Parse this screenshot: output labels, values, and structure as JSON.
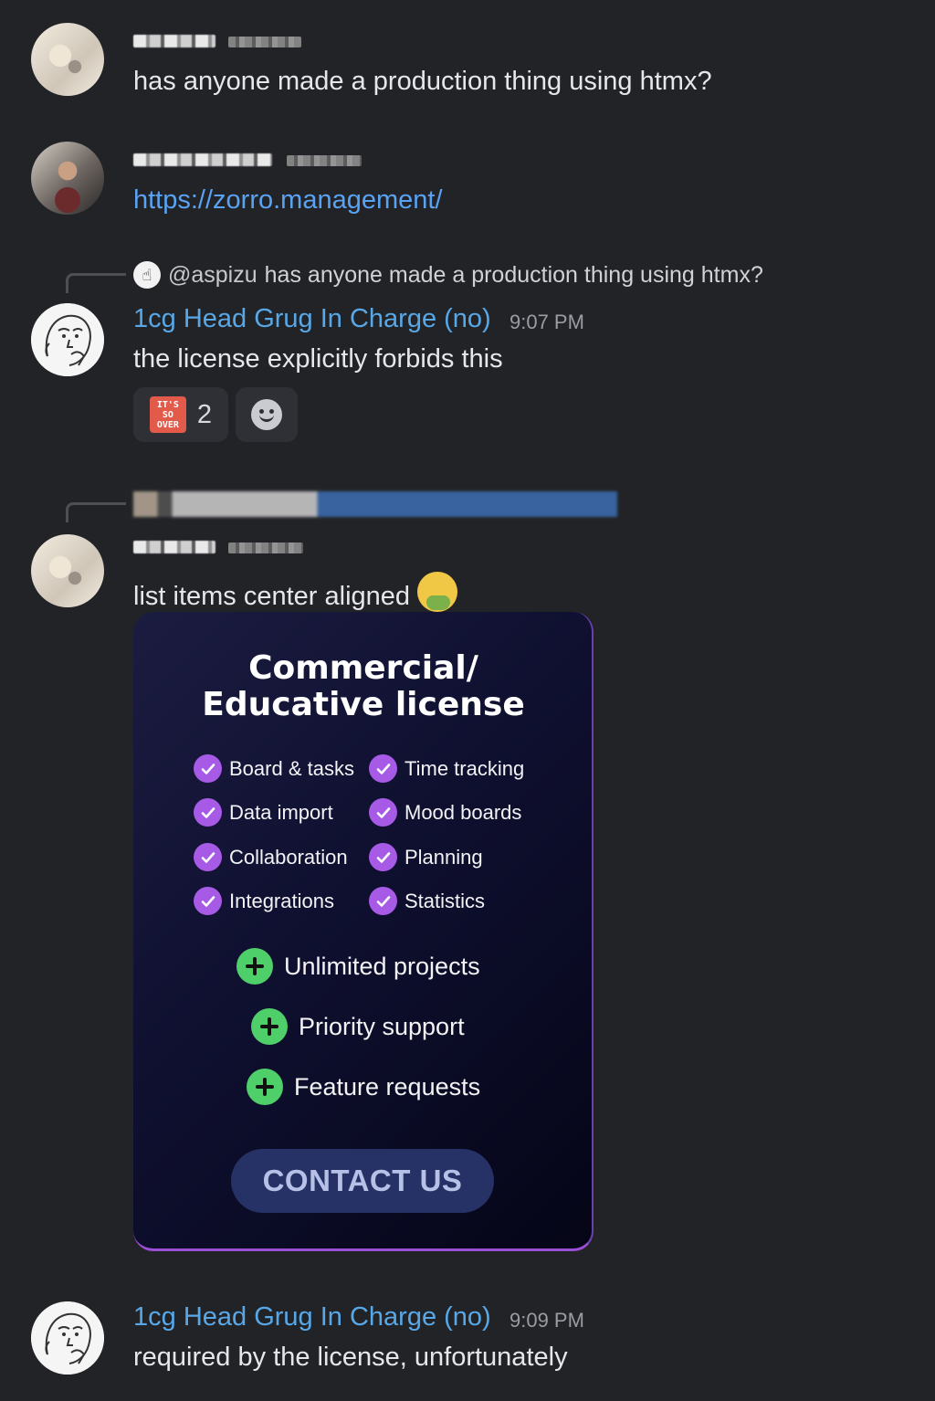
{
  "messages": [
    {
      "text": "has anyone made a production thing using htmx?"
    },
    {
      "link": "https://zorro.management/"
    },
    {
      "reply": {
        "mention": "@aspizu",
        "text": "has anyone made a production thing using htmx?"
      },
      "author": "1cg Head Grug In Charge (no)",
      "time": "9:07 PM",
      "text": "the license explicitly forbids this",
      "reaction": {
        "emoji_text": "IT'S SO OVER",
        "count": "2"
      }
    },
    {
      "text": "list items center aligned"
    },
    {
      "author": "1cg Head Grug In Charge (no)",
      "time": "9:09 PM",
      "text": "required by the license, unfortunately"
    }
  ],
  "card": {
    "title_line1": "Commercial/",
    "title_line2": "Educative license",
    "features_left": [
      "Board & tasks",
      "Data import",
      "Collaboration",
      "Integrations"
    ],
    "features_right": [
      "Time tracking",
      "Mood boards",
      "Planning",
      "Statistics"
    ],
    "extras": [
      "Unlimited projects",
      "Priority support",
      "Feature requests"
    ],
    "cta": "CONTACT US"
  },
  "colors": {
    "background": "#222327",
    "link": "#5aa2f2",
    "author": "#58a8e8",
    "check": "#a65ae6",
    "plus": "#4fcf6a"
  },
  "icons": [
    "pointing-hand-icon",
    "its-so-over-emoji-icon",
    "add-reaction-icon",
    "nauseated-face-emoji-icon",
    "check-icon",
    "plus-icon"
  ]
}
